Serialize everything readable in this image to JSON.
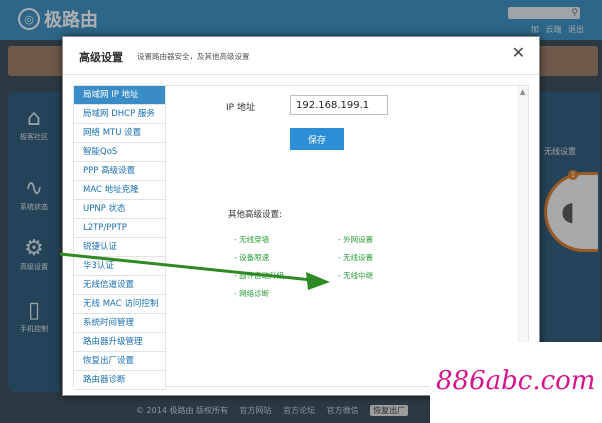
{
  "background": {
    "brand": "极路由",
    "top_links": [
      "加",
      "云端",
      "退出"
    ],
    "side_items": [
      "极客社区",
      "系统状态",
      "高级设置",
      "手机控制"
    ],
    "right_label": "无线设置",
    "badge": "1",
    "footer": [
      "© 2014 极路由 版权所有",
      "官方网站",
      "官方论坛",
      "官方微信",
      "恢复出厂"
    ]
  },
  "dialog": {
    "title": "高级设置",
    "subtitle": "设置路由器安全，及其他高级设置",
    "close": "✕",
    "menu": [
      "局域网 IP 地址",
      "局域网 DHCP 服务",
      "网络 MTU 设置",
      "智能QoS",
      "PPP 高级设置",
      "MAC 地址克隆",
      "UPNP 状态",
      "L2TP/PPTP",
      "锐捷认证",
      "华3认证",
      "无线信道设置",
      "无线 MAC 访问控制",
      "系统时间管理",
      "路由器升级管理",
      "恢复出厂设置",
      "路由器诊断"
    ],
    "active_index": 0,
    "ip_label": "IP 地址",
    "ip_value": "192.168.199.1",
    "save_label": "保存",
    "other_label": "其他高级设置:",
    "links": [
      "- 无线穿墙",
      "- 外网设置",
      "- 设备限速",
      "- 无线设置",
      "- 固件自动升级",
      "- 无线中继",
      "- 网络诊断"
    ]
  },
  "watermark": "886abc.com",
  "colors": {
    "header_blue": "#3b8fc4",
    "active_menu": "#3a8cc7",
    "save_button": "#2c8fd6",
    "link_green": "#2a9d3a",
    "arrow_green": "#2f8a23",
    "watermark_magenta": "#d6158a"
  }
}
